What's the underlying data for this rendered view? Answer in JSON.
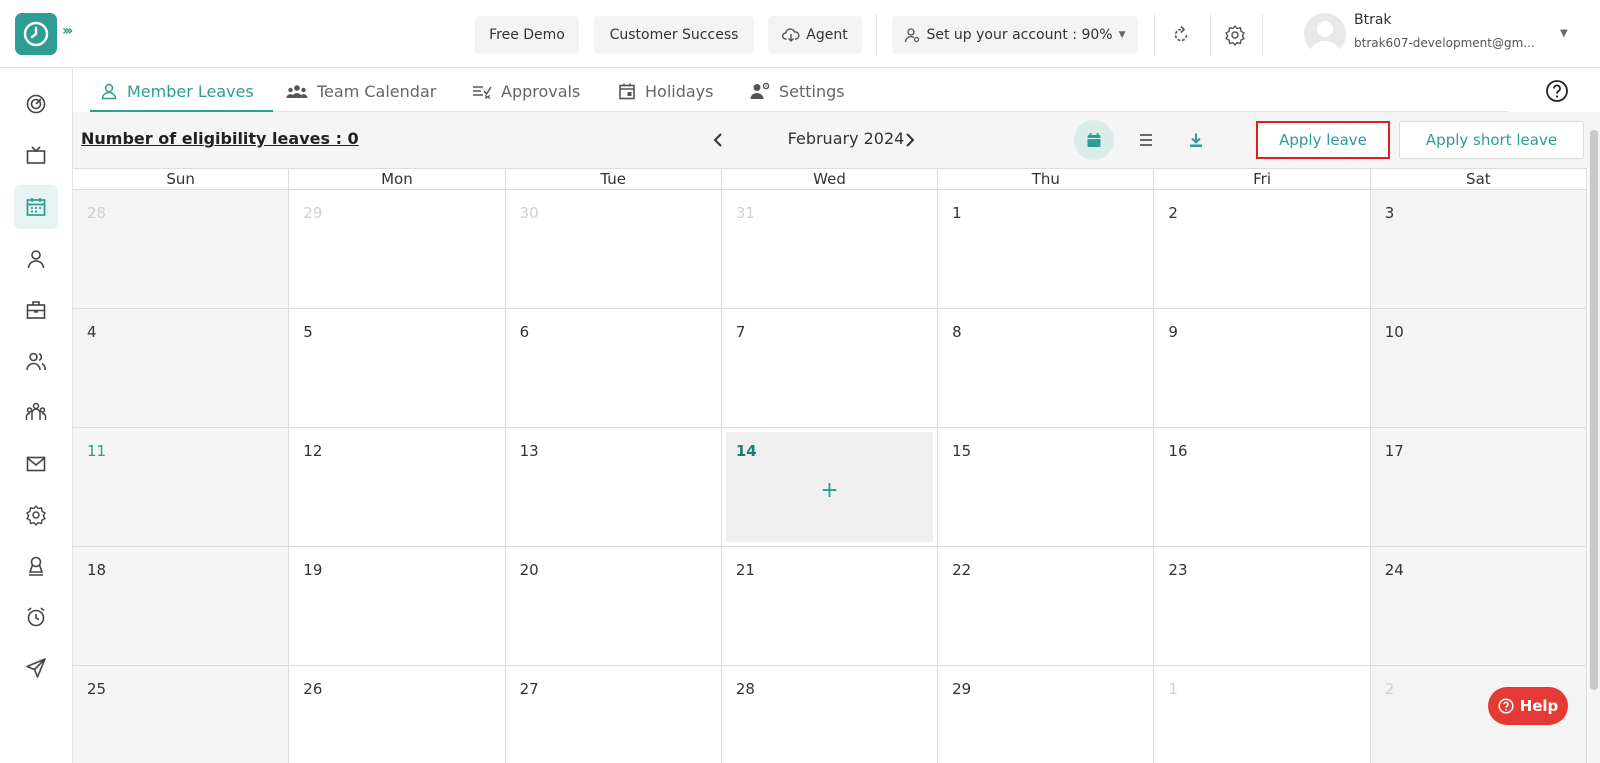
{
  "header": {
    "free_demo": "Free Demo",
    "customer_success": "Customer Success",
    "agent": "Agent",
    "setup_account": "Set up your account : 90%",
    "user_name": "Btrak",
    "user_email": "btrak607-development@gm..."
  },
  "sidebar": {
    "items": [
      {
        "icon": "dashboard-icon"
      },
      {
        "icon": "tv-icon"
      },
      {
        "icon": "calendar-icon",
        "active": true
      },
      {
        "icon": "user-icon"
      },
      {
        "icon": "briefcase-icon"
      },
      {
        "icon": "users-icon"
      },
      {
        "icon": "team-icon"
      },
      {
        "icon": "mail-icon"
      },
      {
        "icon": "settings-icon"
      },
      {
        "icon": "award-icon"
      },
      {
        "icon": "alarm-icon"
      },
      {
        "icon": "send-icon"
      }
    ]
  },
  "tabs": [
    {
      "label": "Member Leaves",
      "active": true
    },
    {
      "label": "Team Calendar"
    },
    {
      "label": "Approvals"
    },
    {
      "label": "Holidays"
    },
    {
      "label": "Settings"
    }
  ],
  "toolbar": {
    "eligibility": "Number of eligibility leaves : 0",
    "month": "February 2024",
    "apply_leave": "Apply leave",
    "apply_short_leave": "Apply short leave"
  },
  "calendar": {
    "weekdays": [
      "Sun",
      "Mon",
      "Tue",
      "Wed",
      "Thu",
      "Fri",
      "Sat"
    ],
    "days": [
      {
        "n": "28",
        "other": true
      },
      {
        "n": "29",
        "other": true
      },
      {
        "n": "30",
        "other": true
      },
      {
        "n": "31",
        "other": true
      },
      {
        "n": "1"
      },
      {
        "n": "2"
      },
      {
        "n": "3"
      },
      {
        "n": "4"
      },
      {
        "n": "5"
      },
      {
        "n": "6"
      },
      {
        "n": "7"
      },
      {
        "n": "8"
      },
      {
        "n": "9"
      },
      {
        "n": "10"
      },
      {
        "n": "11",
        "holiday": true
      },
      {
        "n": "12"
      },
      {
        "n": "13"
      },
      {
        "n": "14",
        "today": true
      },
      {
        "n": "15"
      },
      {
        "n": "16"
      },
      {
        "n": "17"
      },
      {
        "n": "18"
      },
      {
        "n": "19"
      },
      {
        "n": "20"
      },
      {
        "n": "21"
      },
      {
        "n": "22"
      },
      {
        "n": "23"
      },
      {
        "n": "24"
      },
      {
        "n": "25"
      },
      {
        "n": "26"
      },
      {
        "n": "27"
      },
      {
        "n": "28"
      },
      {
        "n": "29"
      },
      {
        "n": "1",
        "other": true
      },
      {
        "n": "2",
        "other": true
      }
    ],
    "add_symbol": "+"
  },
  "help": {
    "label": "Help"
  },
  "colors": {
    "accent": "#2d9d93",
    "highlight_border": "#e02020",
    "help_bg": "#e53935"
  }
}
